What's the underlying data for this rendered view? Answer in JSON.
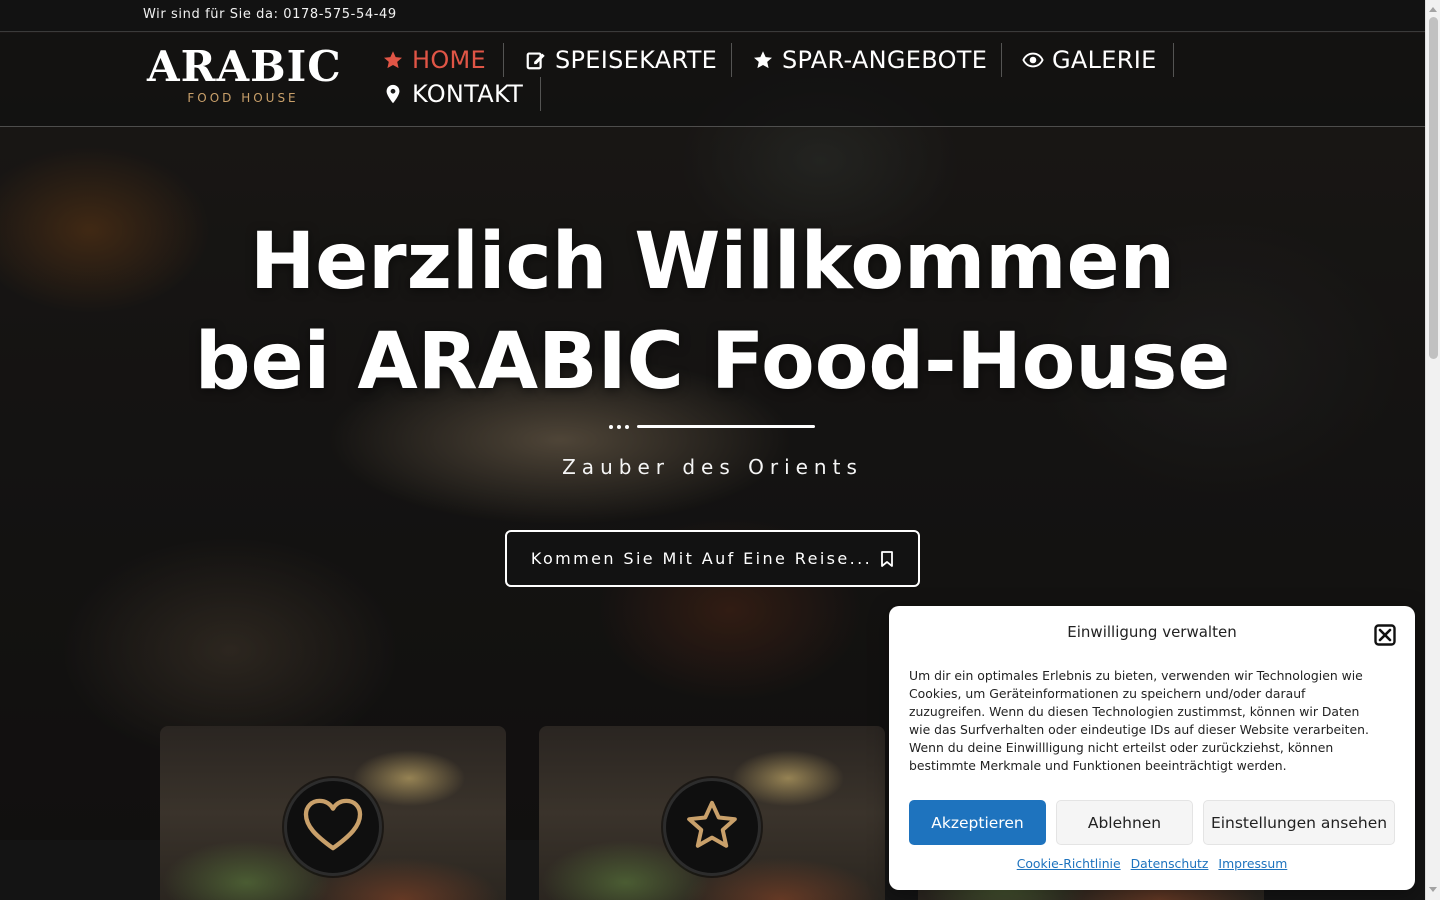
{
  "topbar": {
    "contact_text": "Wir sind für Sie da: 0178-575-54-49"
  },
  "logo": {
    "main": "ARABIC",
    "sub": "FOOD HOUSE"
  },
  "nav": {
    "items": [
      {
        "label": "HOME",
        "icon": "star-icon",
        "active": true
      },
      {
        "label": "SPEISEKARTE",
        "icon": "edit-icon",
        "active": false
      },
      {
        "label": "SPAR-ANGEBOTE",
        "icon": "star-icon",
        "active": false
      },
      {
        "label": "GALERIE",
        "icon": "eye-icon",
        "active": false
      },
      {
        "label": "KONTAKT",
        "icon": "map-pin-icon",
        "active": false
      }
    ]
  },
  "hero": {
    "title_line1": "Herzlich Willkommen",
    "title_line2": "bei ARABIC Food-House",
    "subtitle": "Zauber des Orients",
    "cta_label": "Kommen Sie Mit Auf Eine Reise...",
    "cta_icon": "bookmark-icon"
  },
  "cards": [
    {
      "icon": "heart-icon"
    },
    {
      "icon": "star-icon"
    },
    {
      "icon": ""
    }
  ],
  "consent": {
    "title": "Einwilligung verwalten",
    "text": "Um dir ein optimales Erlebnis zu bieten, verwenden wir Technologien wie Cookies, um Geräteinformationen zu speichern und/oder darauf zuzugreifen. Wenn du diesen Technologien zustimmst, können wir Daten wie das Surfverhalten oder eindeutige IDs auf dieser Website verarbeiten. Wenn du deine Einwillligung nicht erteilst oder zurückziehst, können bestimmte Merkmale und Funktionen beeinträchtigt werden.",
    "accept_label": "Akzeptieren",
    "decline_label": "Ablehnen",
    "settings_label": "Einstellungen ansehen",
    "links": [
      "Cookie-Richtlinie",
      "Datenschutz",
      "Impressum"
    ]
  },
  "colors": {
    "accent_active_nav": "#e05546",
    "gold": "#c9a06a",
    "button_primary": "#1e73be",
    "topbar_bg": "#121212"
  }
}
